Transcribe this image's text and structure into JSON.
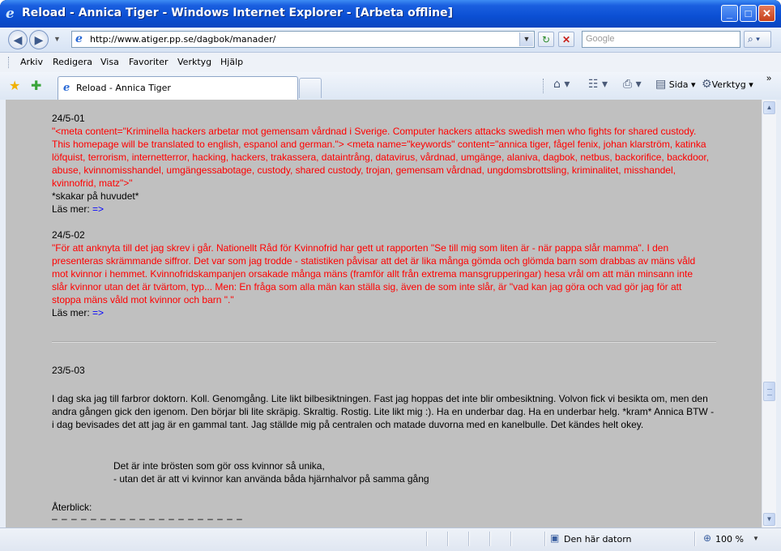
{
  "window": {
    "title": "Reload - Annica Tiger - Windows Internet Explorer - [Arbeta offline]",
    "ie_icon": "ie-logo-icon",
    "min": "_",
    "max": "□",
    "close": "✕"
  },
  "address": {
    "url": "http://www.atiger.pp.se/dagbok/manader/",
    "search_placeholder": "Google",
    "back": "◀",
    "forward": "▶",
    "dropdown": "▼",
    "refresh": "↻",
    "stop": "✕",
    "search_go": "⌕ ▾"
  },
  "menu": {
    "items": [
      "Arkiv",
      "Redigera",
      "Visa",
      "Favoriter",
      "Verktyg",
      "Hjälp"
    ]
  },
  "tabs": {
    "active_label": "Reload - Annica Tiger"
  },
  "toolbar": {
    "home": "⌂ ▾",
    "feeds": "☷ ▾",
    "print": "⎙ ▾",
    "page": "Sida ▾",
    "tools": "Verktyg ▾",
    "more": "»"
  },
  "content": {
    "e1_date": "24/5-01",
    "e1_red": "\"<meta content=\"Kriminella hackers arbetar mot gemensam vårdnad i Sverige. Computer hackers attacks swedish men who fights for shared custody. This homepage will be translated to english, espanol and german.\"> <meta name=\"keywords\" content=\"annica tiger, fågel fenix, johan klarström, katinka löfquist, terrorism, internetterror, hacking, hackers, trakassera, dataintrång, datavirus, vårdnad, umgänge, alaniva, dagbok, netbus, backorifice, backdoor, abuse, kvinnomisshandel, umgängessabotage, custody, shared custody, trojan, gemensam vårdnad, ungdomsbrottsling, kriminalitet, misshandel, kvinnofrid, matz\">\"",
    "e1_after": "*skakar på huvudet*",
    "read_more": "Läs mer:",
    "arrow": "=>",
    "e2_date": "24/5-02",
    "e2_red": "\"För att anknyta till det jag skrev i går. Nationellt Råd för Kvinnofrid har gett ut rapporten \"Se till mig som liten är - när pappa slår mamma\". I den presenteras skrämmande siffror. Det var som jag trodde - statistiken påvisar att det är lika många gömda och glömda barn som drabbas av mäns våld mot kvinnor i hemmet. Kvinnofridskampanjen orsakade många mäns (framför allt från extrema mansgrupperingar) hesa vrål om att män minsann inte slår kvinnor utan det är tvärtom, typ... Men: En fråga som alla män kan ställa sig, även de som inte slår, är \"vad kan jag göra och vad gör jag för att stoppa mäns våld mot kvinnor och barn \".\"",
    "e3_date": "23/5-03",
    "e3_text": "I dag ska jag till farbror doktorn. Koll. Genomgång. Lite likt bilbesiktningen. Fast jag hoppas det inte blir ombesiktning. Volvon fick vi besikta om, men den andra gången gick den igenom. Den börjar bli lite skräpig. Skraltig. Rostig. Lite likt mig :). Ha en underbar dag. Ha en underbar helg. *kram* Annica BTW - i dag bevisades det att jag är en gammal tant. Jag ställde mig på centralen och matade duvorna med en kanelbulle. Det kändes helt okey.",
    "quote1": "Det är inte brösten som gör oss kvinnor så unika,",
    "quote2": "- utan det är att vi kvinnor kan använda båda hjärnhalvor på samma gång",
    "flashback": "Återblick:",
    "dashes": "– – – – – – – – – – – – – – – – – – – –"
  },
  "status": {
    "zone": "Den här datorn",
    "zoom": "100 %",
    "zoom_dd": "▼"
  },
  "colors": {
    "title_blue": "#0b4fd3",
    "content_bg": "#c0c0c0",
    "red_text": "#ff0000",
    "link_blue": "#0000ff"
  }
}
